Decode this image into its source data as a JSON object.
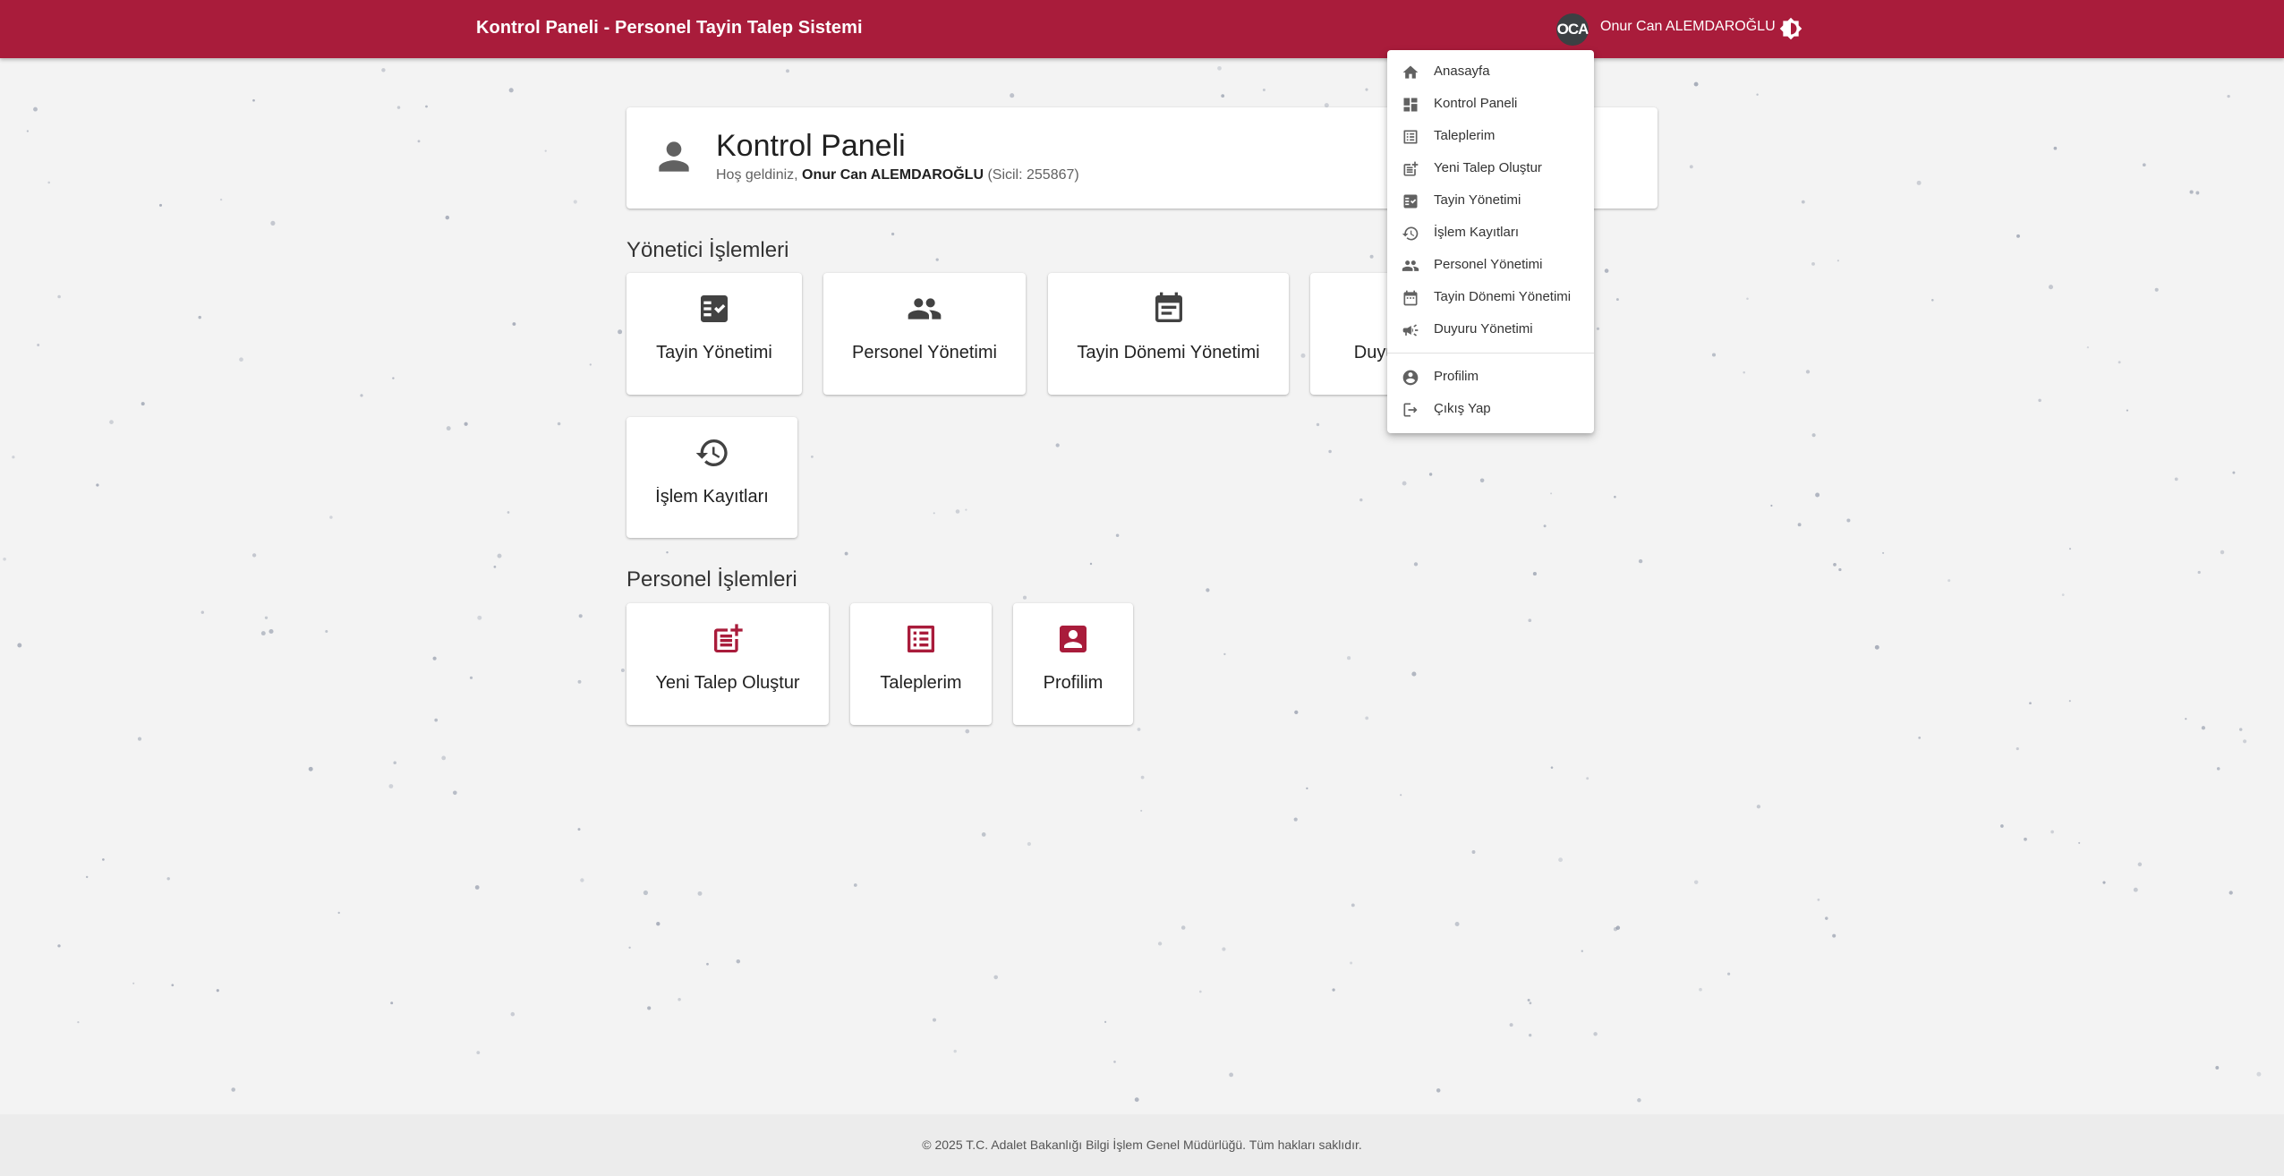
{
  "appbar": {
    "title": "Kontrol Paneli - Personel Tayin Talep Sistemi",
    "avatar_initials": "OCA",
    "user_name": "Onur Can ALEMDAROĞLU",
    "color": "#a91c3b",
    "theme_icon": "brightness-icon"
  },
  "welcome": {
    "title": "Kontrol Paneli",
    "greeting": "Hoş geldiniz, ",
    "user": "Onur Can ALEMDAROĞLU",
    "sicil": " (Sicil: 255867)",
    "icon": "person-icon"
  },
  "admin_section": {
    "title": "Yönetici İşlemleri",
    "tiles": [
      {
        "label": "Tayin Yönetimi",
        "icon": "checklist-icon"
      },
      {
        "label": "Personel Yönetimi",
        "icon": "people-icon"
      },
      {
        "label": "Tayin Dönemi Yönetimi",
        "icon": "calendar-icon"
      },
      {
        "label": "Duyuru Yönetimi",
        "icon": "campaign-icon"
      },
      {
        "label": "İşlem Kayıtları",
        "icon": "history-icon"
      }
    ]
  },
  "personnel_section": {
    "title": "Personel İşlemleri",
    "accent": "#a91c3b",
    "tiles": [
      {
        "label": "Yeni Talep Oluştur",
        "icon": "post-add-icon"
      },
      {
        "label": "Taleplerim",
        "icon": "list-alt-icon"
      },
      {
        "label": "Profilim",
        "icon": "account-box-icon"
      }
    ]
  },
  "menu": {
    "items": [
      {
        "label": "Anasayfa",
        "icon": "home-icon"
      },
      {
        "label": "Kontrol Paneli",
        "icon": "dashboard-icon"
      },
      {
        "label": "Taleplerim",
        "icon": "list-alt-icon"
      },
      {
        "label": "Yeni Talep Oluştur",
        "icon": "post-add-icon"
      },
      {
        "label": "Tayin Yönetimi",
        "icon": "checklist-icon"
      },
      {
        "label": "İşlem Kayıtları",
        "icon": "history-icon"
      },
      {
        "label": "Personel Yönetimi",
        "icon": "people-icon"
      },
      {
        "label": "Tayin Dönemi Yönetimi",
        "icon": "calendar-icon"
      },
      {
        "label": "Duyuru Yönetimi",
        "icon": "campaign-icon"
      },
      {
        "label": "Profilim",
        "icon": "account-circle-icon"
      },
      {
        "label": "Çıkış Yap",
        "icon": "logout-icon"
      }
    ]
  },
  "footer": {
    "text": "© 2025 T.C. Adalet Bakanlığı Bilgi İşlem Genel Müdürlüğü. Tüm hakları saklıdır."
  }
}
